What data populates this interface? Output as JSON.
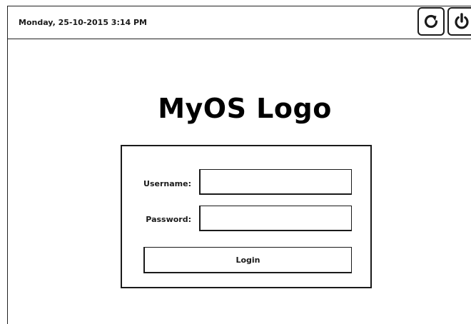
{
  "topbar": {
    "datetime": "Monday, 25-10-2015 3:14 PM",
    "refresh_icon": "refresh-icon",
    "power_icon": "power-icon"
  },
  "logo": {
    "text": "MyOS Logo"
  },
  "login": {
    "username_label": "Username:",
    "username_value": "",
    "password_label": "Password:",
    "password_value": "",
    "button_label": "Login"
  },
  "colors": {
    "stroke": "#1a1a1a",
    "background": "#ffffff"
  }
}
